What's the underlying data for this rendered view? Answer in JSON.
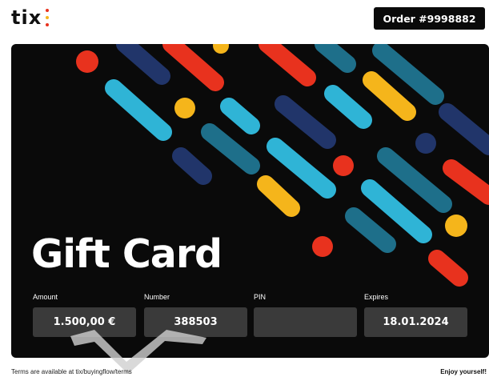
{
  "logo": {
    "text": "tix",
    "dot_colors": [
      "#e8321e",
      "#f5b51b",
      "#e8321e"
    ]
  },
  "header": {
    "order_label": "Order #9998882"
  },
  "card": {
    "title": "Gift Card",
    "fields": [
      {
        "label": "Amount",
        "value": "1.500,00 €"
      },
      {
        "label": "Number",
        "value": "388503"
      },
      {
        "label": "PIN",
        "value": ""
      },
      {
        "label": "Expires",
        "value": "18.01.2024"
      }
    ],
    "colors": {
      "background": "#0a0a0a",
      "red": "#e8321e",
      "yellow": "#f5b51b",
      "cyan": "#2fb4d6",
      "teal": "#1e6f8a",
      "navy": "#21356a",
      "field_box": "#3a3a3a"
    }
  },
  "footer": {
    "terms": "Terms are available at tix/buyingflow/terms",
    "tagline": "Enjoy yourself!"
  }
}
